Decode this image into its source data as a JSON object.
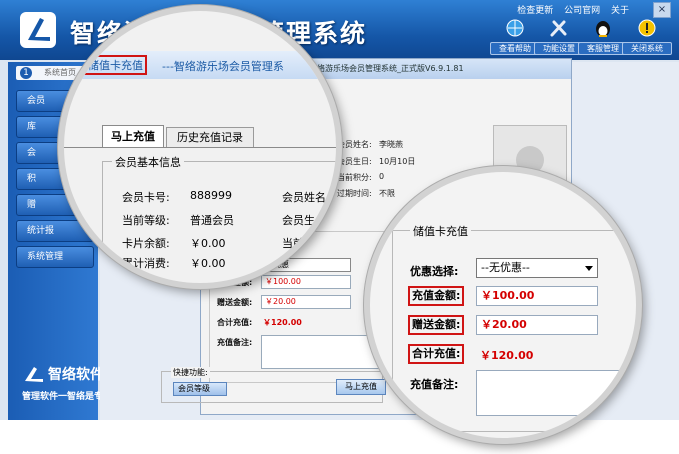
{
  "app": {
    "title": "智络游乐场会员管理系统",
    "top_links": [
      "检查更新",
      "公司官网",
      "关于"
    ],
    "toolbar": [
      {
        "label": "查看帮助",
        "icon": "globe-icon"
      },
      {
        "label": "功能设置",
        "icon": "tools-icon"
      },
      {
        "label": "客服管理",
        "icon": "qq-penguin-icon"
      },
      {
        "label": "关闭系统",
        "icon": "warning-icon"
      }
    ]
  },
  "sidebar": {
    "first_tab_number": "1",
    "first_tab_label": "系统首页",
    "items": [
      "会员",
      "库",
      "会",
      "积",
      "赠",
      "统计报",
      "系统管理"
    ],
    "brand_name": "智络软件",
    "brand_slogan": "管理软件一智络是专家"
  },
  "dialog": {
    "title_full": "智络游乐场会员管理系统_正式版V6.9.1.81",
    "member_name_label": "会员姓名:",
    "member_name_value": "李晓燕",
    "birthday_label": "会员生日:",
    "birthday_value": "10月10日",
    "points_label": "当前积分:",
    "points_value": "0",
    "expiry_label": "过期时间:",
    "expiry_value": "不限",
    "promo_value": "无优惠",
    "recharge_label": "充值金额:",
    "recharge_value": "￥100.00",
    "gift_label": "赠送金额:",
    "gift_value": "￥20.00",
    "total_label": "合计充值:",
    "total_value": "￥120.00",
    "remark_label": "充值备注:",
    "quick_label": "快捷功能:",
    "quick_member_btn": "会员等级",
    "charge_btn": "马上充值"
  },
  "zoom1": {
    "dialog_title": "储值卡充值",
    "dialog_subtitle": "---智络游乐场会员管理系",
    "tabs": [
      "马上充值",
      "历史充值记录"
    ],
    "group_title": "会员基本信息",
    "fields": [
      {
        "label": "会员卡号:",
        "value": "888999"
      },
      {
        "label": "当前等级:",
        "value": "普通会员"
      },
      {
        "label": "卡片余额:",
        "value": "￥0.00"
      },
      {
        "label": "累计消费:",
        "value": "￥0.00"
      }
    ],
    "right_labels": [
      "会员姓名",
      "会员生",
      "当前"
    ]
  },
  "zoom2": {
    "group_title": "储值卡充值",
    "promo_label": "优惠选择:",
    "promo_value": "--无优惠--",
    "recharge_label": "充值金额:",
    "recharge_value": "￥100.00",
    "gift_label": "赠送金额:",
    "gift_value": "￥20.00",
    "total_label": "合计充值:",
    "total_value": "￥120.00",
    "remark_label": "充值备注:"
  }
}
